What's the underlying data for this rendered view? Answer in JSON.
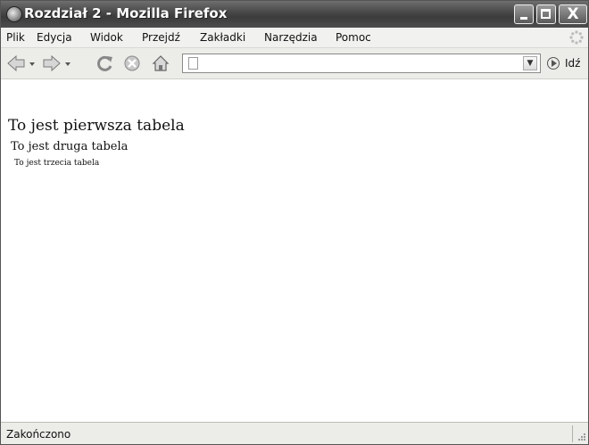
{
  "window": {
    "title": "Rozdział 2 - Mozilla Firefox",
    "controls": {
      "minimize": "_",
      "maximize": "□",
      "close": "X"
    }
  },
  "menu": {
    "items": [
      {
        "label": "Plik"
      },
      {
        "label": "Edycja"
      },
      {
        "label": "Widok"
      },
      {
        "label": "Przejdź"
      },
      {
        "label": "Zakładki"
      },
      {
        "label": "Narzędzia"
      },
      {
        "label": "Pomoc"
      }
    ]
  },
  "navigation": {
    "address_value": "",
    "go_label": "Idź",
    "icons": [
      "back-arrow-icon",
      "forward-arrow-icon",
      "reload-icon",
      "stop-icon",
      "home-icon",
      "page-icon",
      "go-icon"
    ]
  },
  "content": {
    "table1": "To jest pierwsza tabela",
    "table2": "To jest druga tabela",
    "table3": "To jest trzecia tabela"
  },
  "status": {
    "text": "Zakończono"
  }
}
